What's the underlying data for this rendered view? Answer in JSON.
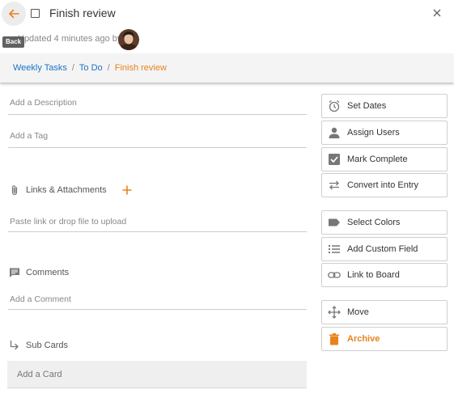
{
  "header": {
    "back_tooltip": "Back",
    "title": "Finish review",
    "updated_text": "Updated 4 minutes ago by"
  },
  "breadcrumb": {
    "items": [
      "Weekly Tasks",
      "To Do",
      "Finish review"
    ],
    "separator": "/"
  },
  "fields": {
    "description_placeholder": "Add a Description",
    "tag_placeholder": "Add a Tag",
    "links_title": "Links & Attachments",
    "link_placeholder": "Paste link or drop file to upload",
    "comments_title": "Comments",
    "comment_placeholder": "Add a Comment",
    "subcards_title": "Sub Cards",
    "add_card_placeholder": "Add a Card"
  },
  "actions": [
    {
      "label": "Set Dates",
      "icon": "alarm-clock-icon"
    },
    {
      "label": "Assign Users",
      "icon": "person-icon"
    },
    {
      "label": "Mark Complete",
      "icon": "checkbox-icon"
    },
    {
      "label": "Convert into Entry",
      "icon": "swap-arrows-icon"
    },
    {
      "label": "Select Colors",
      "icon": "tag-label-icon"
    },
    {
      "label": "Add Custom Field",
      "icon": "list-icon"
    },
    {
      "label": "Link to Board",
      "icon": "link-icon"
    },
    {
      "label": "Move",
      "icon": "move-arrows-icon"
    },
    {
      "label": "Archive",
      "icon": "trash-icon"
    }
  ],
  "colors": {
    "accent": "#e8821e",
    "link": "#1a73c6"
  }
}
